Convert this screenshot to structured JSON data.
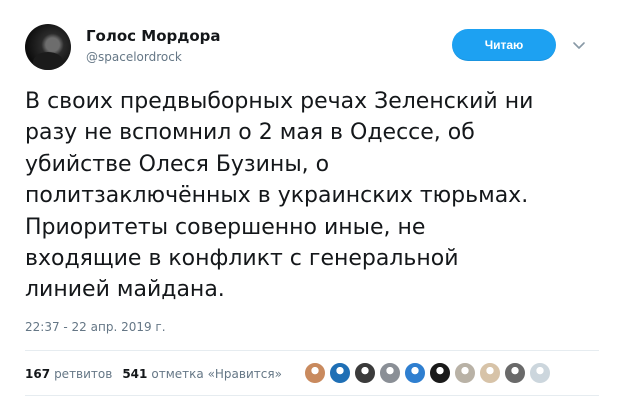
{
  "author": {
    "name": "Голос Мордора",
    "handle": "@spacelordrock"
  },
  "follow_button": {
    "label": "Читаю"
  },
  "tweet": {
    "text": "В своих предвыборных речах Зеленский ни\nразу не вспомнил о 2 мая в Одессе, об\nубийстве Олеся Бузины, о\nполитзаключённых в украинских тюрьмах.\nПриоритеты совершенно иные, не\nвходящие в конфликт с генеральной\nлинией майдана.",
    "timestamp": "22:37 - 22 апр. 2019 г."
  },
  "stats": {
    "retweets_count": "167",
    "retweets_label": "ретвитов",
    "likes_count": "541",
    "likes_label": "отметка «Нравится»"
  },
  "likers": [
    {
      "icon": "avatar-photo-icon",
      "color": "#c98a5e"
    },
    {
      "icon": "avatar-blue-icon",
      "color": "#1f6fb5"
    },
    {
      "icon": "avatar-dark-icon",
      "color": "#3b3b3b"
    },
    {
      "icon": "avatar-gray-icon",
      "color": "#8a8f96"
    },
    {
      "icon": "avatar-blue2-icon",
      "color": "#2f7fd0"
    },
    {
      "icon": "avatar-black-icon",
      "color": "#1a1a1a"
    },
    {
      "icon": "avatar-face-icon",
      "color": "#b9b2a6"
    },
    {
      "icon": "avatar-tan-icon",
      "color": "#d7c3a8"
    },
    {
      "icon": "avatar-man-icon",
      "color": "#6a6a6a"
    },
    {
      "icon": "avatar-default-icon",
      "color": "#ccd6dd"
    }
  ]
}
